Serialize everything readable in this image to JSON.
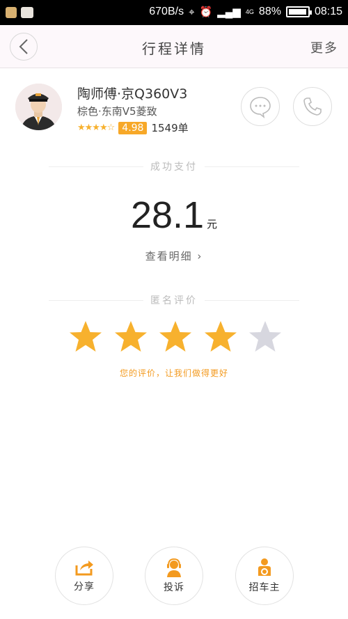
{
  "status_bar": {
    "speed": "670B/s",
    "battery_percent": "88%",
    "time": "08:15",
    "network": "4G"
  },
  "nav": {
    "title": "行程详情",
    "more_label": "更多"
  },
  "driver": {
    "name_plate": "陶师傅·京Q360V3",
    "car": "棕色·东南V5菱致",
    "star_rating": 4.5,
    "score": "4.98",
    "orders": "1549单"
  },
  "payment": {
    "section_label": "成功支付",
    "amount": "28.1",
    "unit": "元",
    "details_link": "查看明细 ›"
  },
  "rating": {
    "section_label": "匿名评价",
    "stars_selected": 4,
    "stars_total": 5,
    "hint": "您的评价，让我们做得更好"
  },
  "actions": [
    {
      "label": "分享",
      "icon": "share-icon"
    },
    {
      "label": "投诉",
      "icon": "complaint-agent-icon"
    },
    {
      "label": "招车主",
      "icon": "driver-seat-icon"
    }
  ],
  "colors": {
    "accent": "#f7a828",
    "star_on": "#f7b12e",
    "star_off": "#d7d7df",
    "hint": "#f39a1f"
  }
}
